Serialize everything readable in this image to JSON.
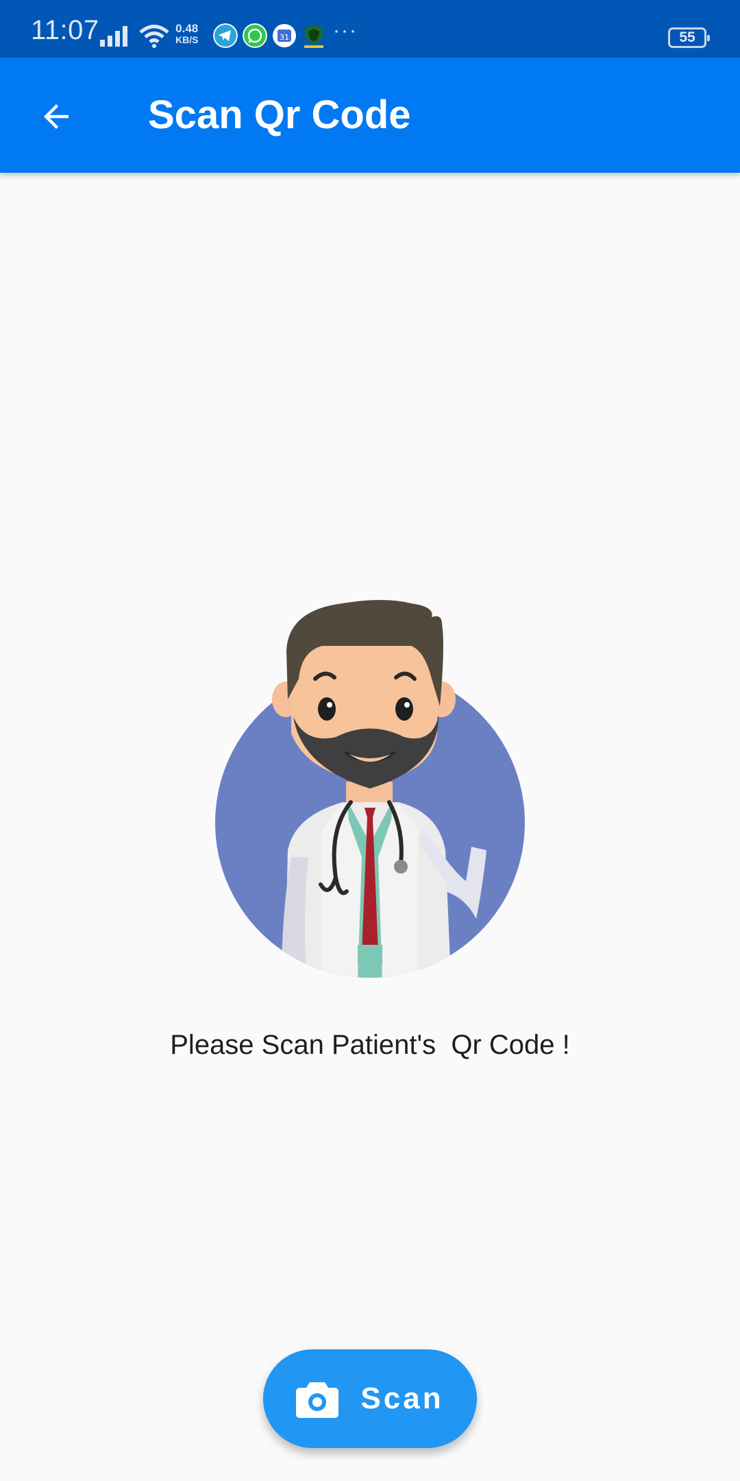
{
  "status_bar": {
    "time": "11:07",
    "net_speed_value": "0.48",
    "net_speed_unit": "KB/S",
    "more": "···",
    "battery": "55",
    "icons": [
      "signal-icon",
      "wifi-icon",
      "telegram-icon",
      "whatsapp-icon",
      "calendar-icon",
      "shield-app-icon"
    ],
    "calendar_day": "31"
  },
  "app_bar": {
    "title": "Scan Qr Code",
    "back_icon": "arrow-back-icon",
    "background": "#0079f2"
  },
  "main": {
    "illustration": "doctor-avatar",
    "instruction": "Please Scan Patient's  Qr Code !"
  },
  "fab": {
    "label": "Scan",
    "icon": "camera-icon",
    "background": "#2196f3"
  },
  "colors": {
    "status_bar": "#0157b6",
    "background": "#fafafa",
    "avatar_circle": "#6b80c3"
  }
}
